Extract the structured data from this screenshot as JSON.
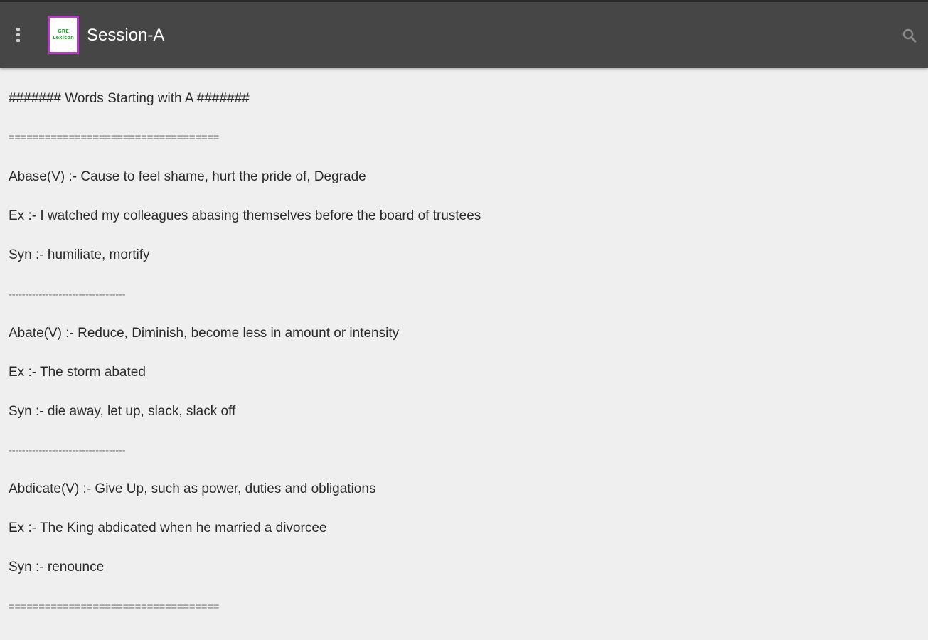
{
  "app": {
    "logo_text_top": "GRE",
    "logo_text_bottom": "Lexicon",
    "logo_color": "#b43cc8",
    "logo_text_color": "#2eaa3c",
    "toolbar_color": "#464646",
    "title": "Session-A",
    "menu_icon": "hamburger-menu-icon",
    "search_icon": "search-icon"
  },
  "content": {
    "lines": [
      "####### Words Starting with A #######",
      "===================================",
      "Abase(V) :- Cause to feel shame, hurt the pride of, Degrade",
      "Ex :- I watched my colleagues abasing themselves before the board of trustees",
      "Syn :- humiliate, mortify",
      "-----------------------------------",
      "Abate(V) :- Reduce, Diminish, become less in amount or intensity",
      "Ex :- The storm abated",
      "Syn :- die away, let up, slack, slack off",
      "-----------------------------------",
      "Abdicate(V) :- Give Up, such as power, duties and obligations",
      "Ex :- The King abdicated when he married a divorcee",
      "Syn :- renounce",
      "==================================="
    ]
  }
}
